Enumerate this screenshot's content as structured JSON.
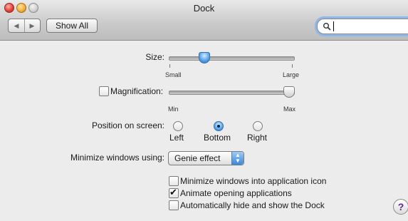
{
  "window": {
    "title": "Dock"
  },
  "toolbar": {
    "show_all_label": "Show All"
  },
  "search": {
    "value": ""
  },
  "size": {
    "label": "Size:",
    "min_label": "Small",
    "max_label": "Large",
    "value_fraction": 0.28
  },
  "magnification": {
    "label": "Magnification:",
    "checked": false,
    "min_label": "Min",
    "max_label": "Max",
    "value_fraction": 0.96
  },
  "position": {
    "label": "Position on screen:",
    "options": [
      "Left",
      "Bottom",
      "Right"
    ],
    "selected": "Bottom"
  },
  "minimize": {
    "label": "Minimize windows using:",
    "selected": "Genie effect"
  },
  "options": [
    {
      "label": "Minimize windows into application icon",
      "checked": false
    },
    {
      "label": "Animate opening applications",
      "checked": true
    },
    {
      "label": "Automatically hide and show the Dock",
      "checked": false
    }
  ],
  "help": {
    "label": "?"
  },
  "colors": {
    "accent": "#3d86d8"
  },
  "icons": {
    "close": "close-icon",
    "minimize": "minimize-icon",
    "zoom": "zoom-icon",
    "back": "back-icon",
    "forward": "forward-icon",
    "search": "search-icon",
    "check": "check-icon"
  }
}
